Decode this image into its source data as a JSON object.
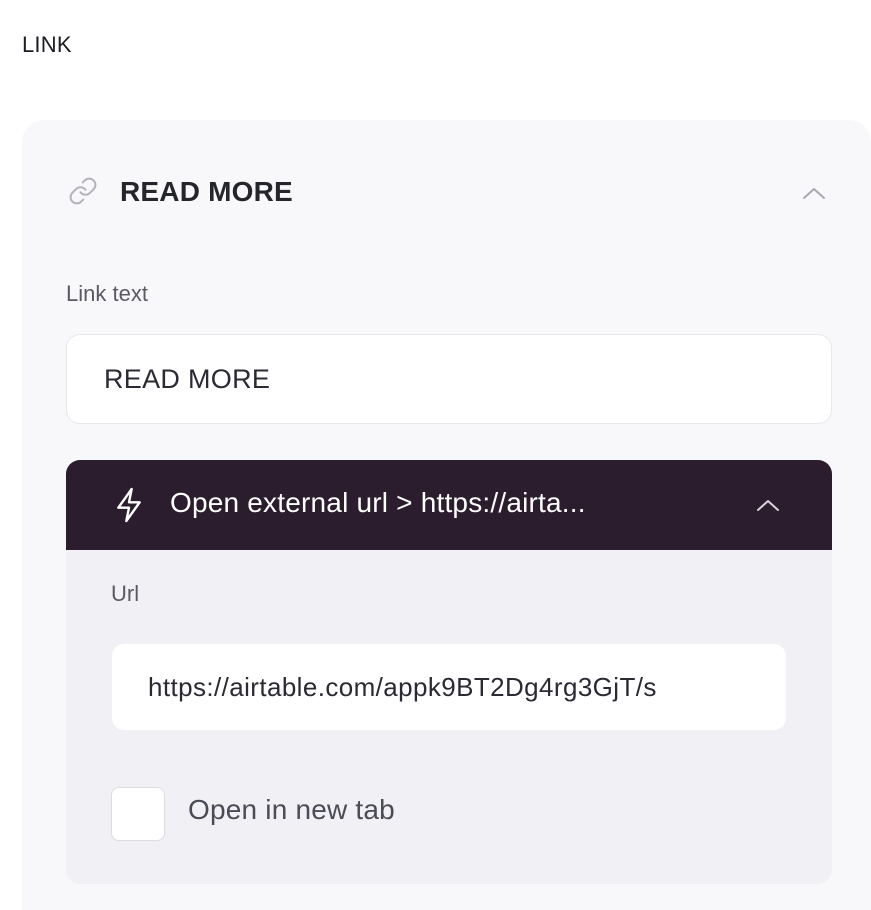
{
  "section": {
    "label": "LINK"
  },
  "link_card": {
    "icon": "link-icon",
    "title": "READ MORE",
    "toggle_icon": "chevron-up-icon",
    "link_text_label": "Link text",
    "link_text_value": "READ MORE"
  },
  "action": {
    "icon": "lightning-bolt-icon",
    "title": "Open external url > https://airta...",
    "toggle_icon": "chevron-up-icon",
    "header_color": "#2b1d2e",
    "url_label": "Url",
    "url_value": "https://airtable.com/appk9BT2Dg4rg3GjT/s",
    "new_tab_label": "Open in new tab",
    "new_tab_checked": false
  }
}
